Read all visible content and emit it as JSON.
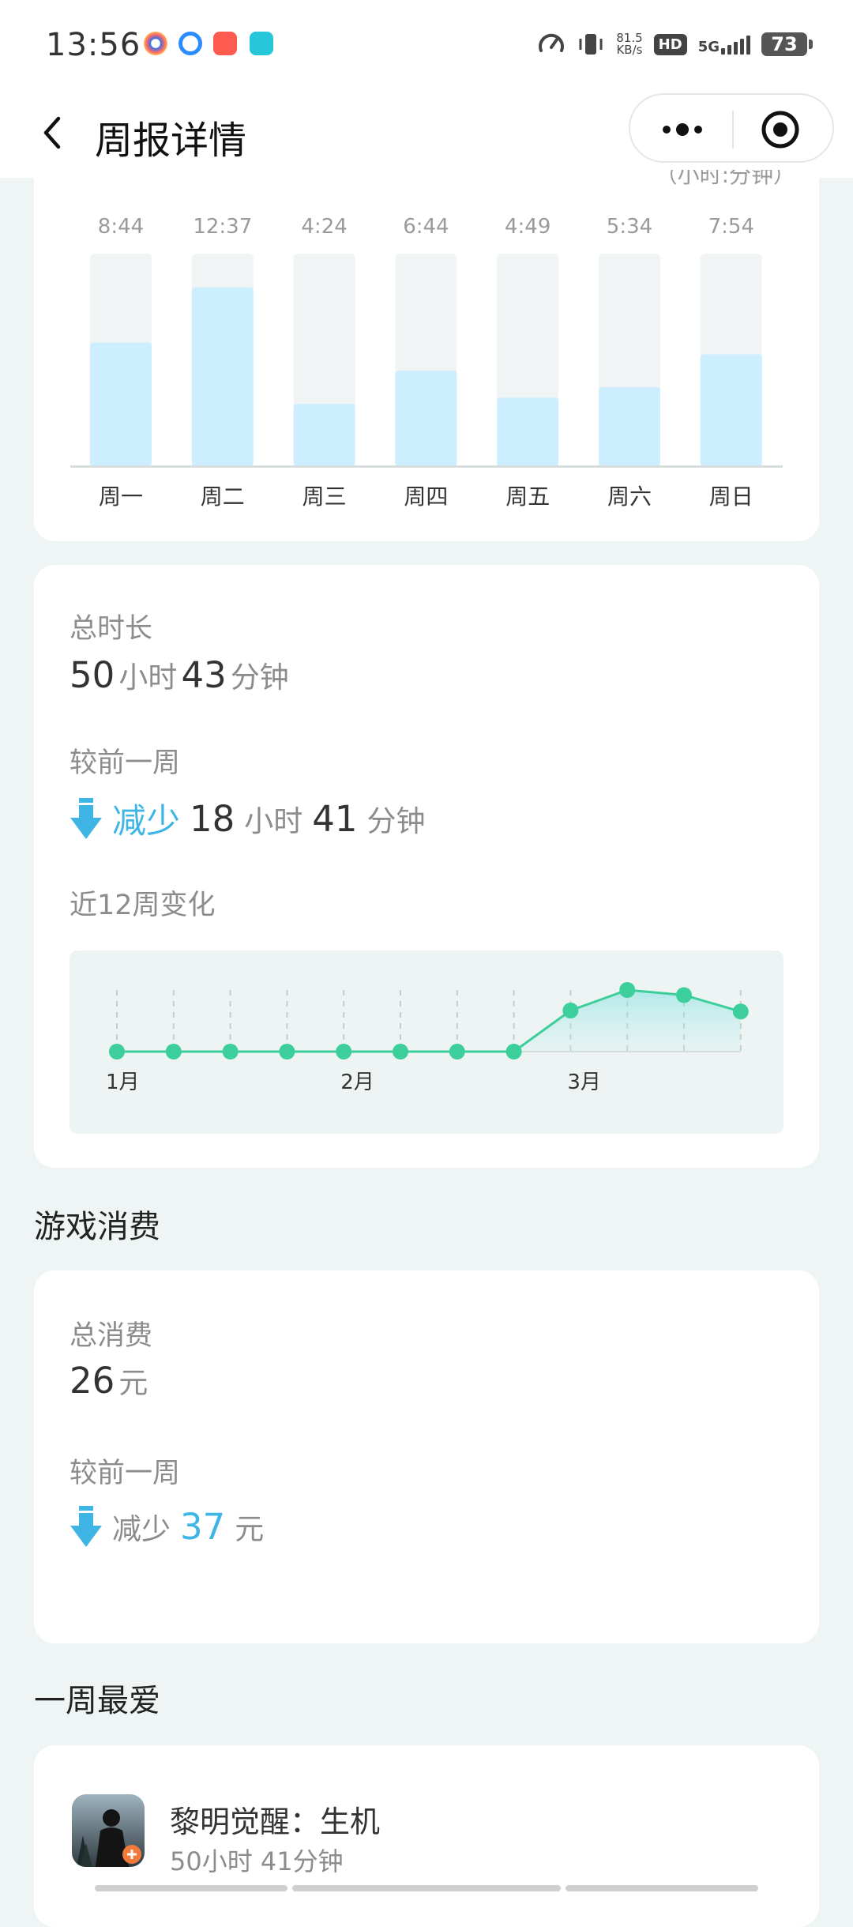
{
  "status_bar": {
    "time": "13:56",
    "net_speed_value": "81.5",
    "net_speed_unit": "KB/s",
    "hd_badge": "HD",
    "network": "5G",
    "battery": "73",
    "icons": [
      "speed-meter-icon",
      "vibrate-icon",
      "signal-icon",
      "battery-icon"
    ]
  },
  "nav": {
    "title": "周报详情",
    "icons": [
      "back-arrow-icon",
      "more-dots-icon",
      "close-target-icon"
    ]
  },
  "bar_card": {
    "unit_label": "（小时:分钟）",
    "chart_data": {
      "type": "bar",
      "categories": [
        "周一",
        "周二",
        "周三",
        "周四",
        "周五",
        "周六",
        "周日"
      ],
      "values": [
        8.73,
        12.62,
        4.4,
        6.73,
        4.82,
        5.57,
        7.9
      ],
      "value_labels": [
        "8:44",
        "12:37",
        "4:24",
        "6:44",
        "4:49",
        "5:34",
        "7:54"
      ],
      "ylim": [
        0,
        15
      ],
      "bar_color": "#cdeeff",
      "track_color": "#f0f4f4"
    }
  },
  "total_card": {
    "total_label": "总时长",
    "total_hours": "50",
    "hours_unit": "小时",
    "total_minutes": "43",
    "minutes_unit": "分钟",
    "compare_label": "较前一周",
    "compare_direction": "减少",
    "compare_hours": "18",
    "compare_hours_unit": "小时",
    "compare_minutes": "41",
    "compare_minutes_unit": "分钟",
    "trend_label": "近12周变化",
    "chart_data": {
      "type": "line",
      "x": [
        1,
        2,
        3,
        4,
        5,
        6,
        7,
        8,
        9,
        10,
        11,
        12
      ],
      "values": [
        0,
        0,
        0,
        0,
        0,
        0,
        0,
        0,
        40,
        60,
        55,
        39
      ],
      "month_labels": [
        {
          "label": "1月",
          "at": 1
        },
        {
          "label": "2月",
          "at": 5
        },
        {
          "label": "3月",
          "at": 9
        }
      ],
      "line_color": "#3ccf9c",
      "grid": true
    }
  },
  "spend_section": {
    "title": "游戏消费",
    "total_label": "总消费",
    "total_value": "26",
    "currency_unit": "元",
    "compare_label": "较前一周",
    "compare_direction": "减少",
    "compare_value": "37",
    "compare_unit": "元"
  },
  "favorite_section": {
    "title": "一周最爱",
    "game_name": "黎明觉醒：生机",
    "game_time": "50小时 41分钟",
    "game_icon": "game-cover-icon"
  },
  "colors": {
    "accent_blue": "#3eb5e5",
    "accent_green": "#3ccf9c",
    "page_bg": "#eef5f4"
  }
}
